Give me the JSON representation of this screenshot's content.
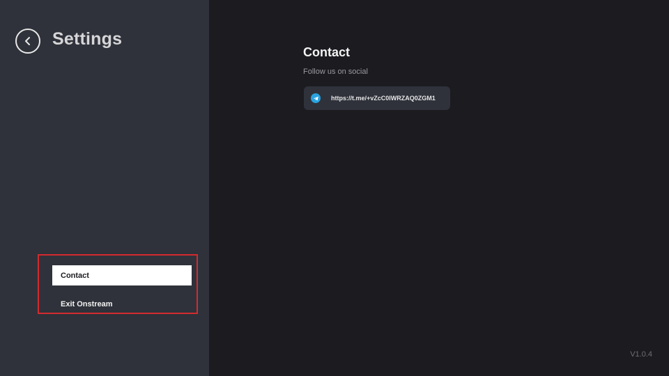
{
  "sidebar": {
    "title": "Settings",
    "back_icon": "chevron-left-icon",
    "menu": [
      {
        "label": "Contact",
        "active": true
      },
      {
        "label": "Exit Onstream",
        "active": false
      }
    ]
  },
  "main": {
    "section_title": "Contact",
    "subtitle": "Follow us on social",
    "social_links": [
      {
        "icon": "telegram-icon",
        "url": "https://t.me/+vZcC0lWRZAQ0ZGM1"
      }
    ]
  },
  "footer": {
    "version": "V1.0.4"
  },
  "colors": {
    "sidebar_bg": "#2f323a",
    "main_bg": "#1b1b20",
    "highlight_border": "#d42a2f",
    "telegram": "#2aa3df"
  }
}
